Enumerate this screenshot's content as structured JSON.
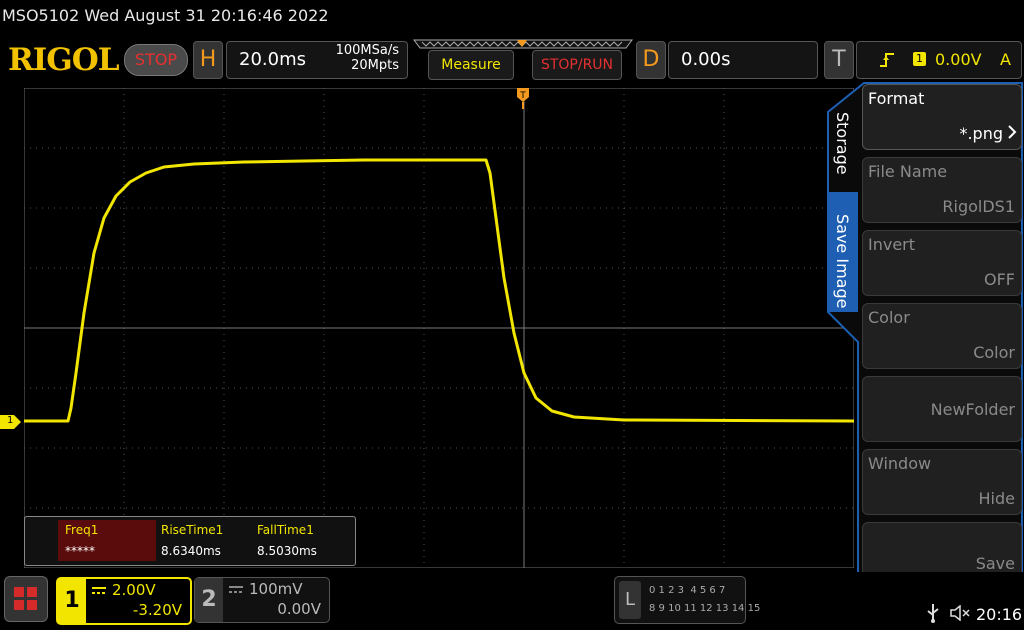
{
  "status_line": "MSO5102  Wed August 31 20:16:46 2022",
  "logo": "RIGOL",
  "run_state": "STOP",
  "horizontal": {
    "letter": "H",
    "timebase": "20.0ms",
    "sample_rate": "100MSa/s",
    "mem_depth": "20Mpts"
  },
  "buttons": {
    "measure": "Measure",
    "stoprun": "STOP/RUN"
  },
  "delay": {
    "letter": "D",
    "value": "0.00s"
  },
  "trigger": {
    "letter": "T",
    "channel": "1",
    "level": "0.00V",
    "mode": "A"
  },
  "side_menu": {
    "tab_storage": "Storage",
    "tab_save_image": "Save Image",
    "items": [
      {
        "title": "Format",
        "value": "*.png"
      },
      {
        "title": "File Name",
        "value": "RigolDS1"
      },
      {
        "title": "Invert",
        "value": "OFF"
      },
      {
        "title": "Color",
        "value": "Color"
      },
      {
        "title": "",
        "value": "NewFolder"
      },
      {
        "title": "Window",
        "value": "Hide"
      },
      {
        "title": "",
        "value": "Save"
      }
    ]
  },
  "measurements": {
    "headers": [
      "Freq1",
      "RiseTime1",
      "FallTime1"
    ],
    "values": [
      "*****",
      "8.6340ms",
      "8.5030ms"
    ]
  },
  "channel1": {
    "num": "1",
    "scale": "2.00V",
    "offset": "-3.20V"
  },
  "channel2": {
    "num": "2",
    "scale": "100mV",
    "offset": "0.00V"
  },
  "logic": {
    "letter": "L",
    "row1": "0 1 2 3  4 5 6 7",
    "row2": "8 9 10 11 12 13 14 15"
  },
  "ch1_marker": "1",
  "clock": "20:16",
  "colors": {
    "ch1": "#f2e600",
    "accent": "#f39a1e",
    "stop": "#e53030",
    "menu_blue": "#1e5fb4"
  }
}
